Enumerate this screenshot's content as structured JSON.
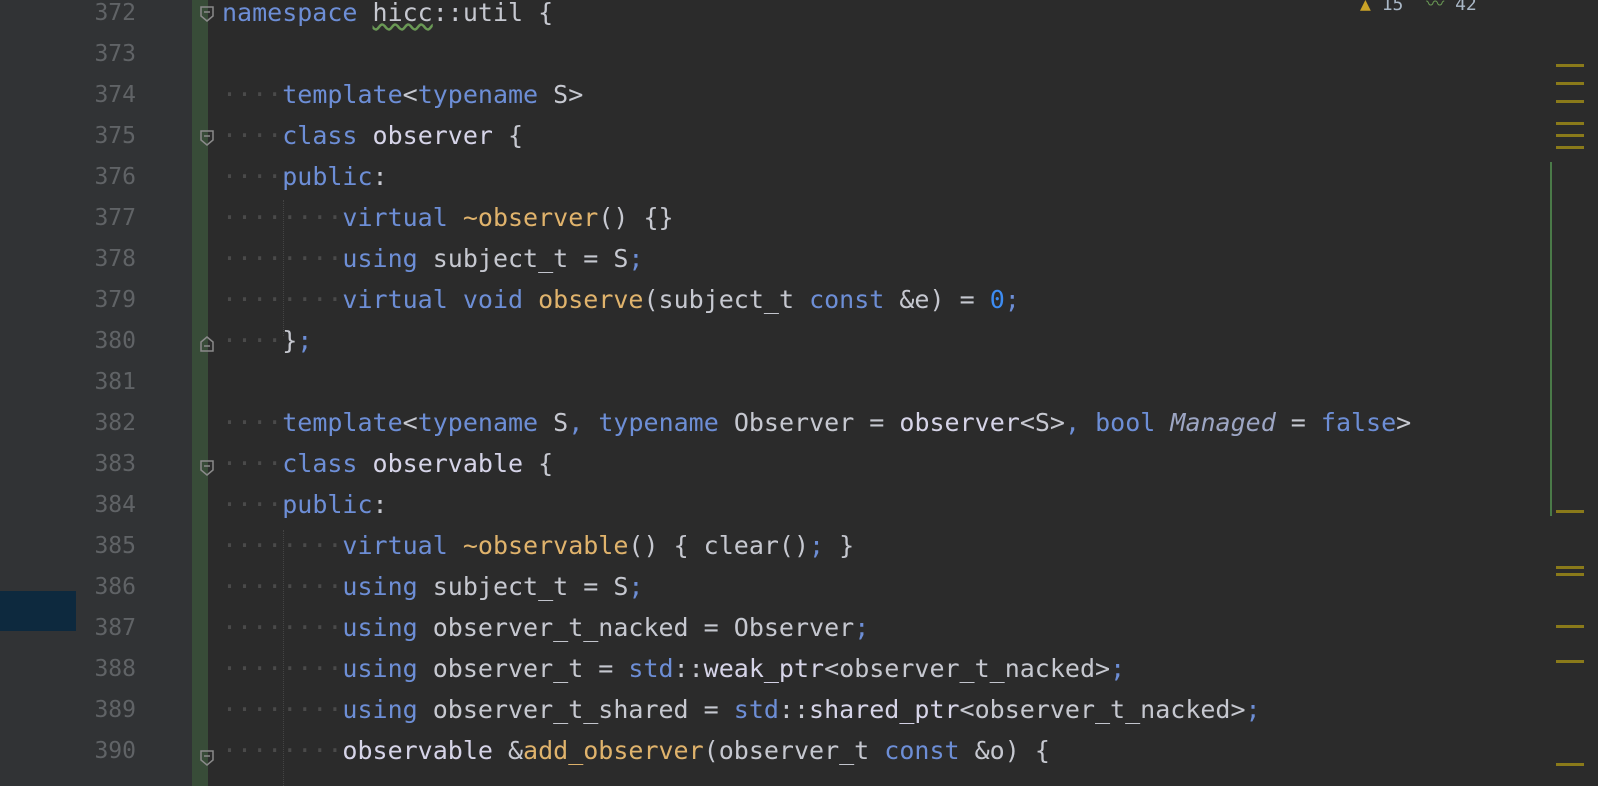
{
  "gutter": {
    "line_numbers": [
      "372",
      "373",
      "374",
      "375",
      "376",
      "377",
      "378",
      "379",
      "380",
      "381",
      "382",
      "383",
      "384",
      "385",
      "386",
      "387",
      "388",
      "389",
      "390"
    ]
  },
  "status": {
    "warnings": "15",
    "weak_warnings": "42"
  },
  "code_lines": {
    "l372": {
      "t1": "namespace",
      "t2": " ",
      "t3": "hicc",
      "t4": "::",
      "t5": "util",
      "t6": " {"
    },
    "l374": {
      "t1": "template",
      "t2": "<",
      "t3": "typename",
      "t4": " S>"
    },
    "l375": {
      "t1": "class",
      "t2": " ",
      "t3": "observer",
      "t4": " {"
    },
    "l376": {
      "t1": "public",
      "t2": ":"
    },
    "l377": {
      "t1": "virtual",
      "t2": " ",
      "t3": "~observer",
      "t4": "() {}"
    },
    "l378": {
      "t1": "using",
      "t2": " subject_t = S",
      "t3": ";"
    },
    "l379": {
      "t1": "virtual",
      "t2": " ",
      "t3": "void",
      "t4": " ",
      "t5": "observe",
      "t6": "(subject_t ",
      "t7": "const",
      "t8": " &e) = ",
      "t9": "0",
      "t10": ";"
    },
    "l380": {
      "t1": "}",
      "t2": ";"
    },
    "l382": {
      "t1": "template",
      "t2": "<",
      "t3": "typename",
      "t4": " S",
      "t5": ",",
      "t6": " ",
      "t7": "typename",
      "t8": " Observer = ",
      "t9": "observer",
      "t10": "<S>",
      "t11": ",",
      "t12": " ",
      "t13": "bool",
      "t14": " ",
      "t15": "Managed",
      "t16": " = ",
      "t17": "false",
      "t18": ">"
    },
    "l383": {
      "t1": "class",
      "t2": " ",
      "t3": "observable",
      "t4": " {"
    },
    "l384": {
      "t1": "public",
      "t2": ":"
    },
    "l385": {
      "t1": "virtual",
      "t2": " ",
      "t3": "~observable",
      "t4": "() { clear()",
      "t5": ";",
      "t6": " }"
    },
    "l386": {
      "t1": "using",
      "t2": " subject_t = S",
      "t3": ";"
    },
    "l387": {
      "t1": "using",
      "t2": " observer_t_nacked = Observer",
      "t3": ";"
    },
    "l388": {
      "t1": "using",
      "t2": " observer_t = ",
      "t3": "std",
      "t4": "::",
      "t5": "weak_ptr",
      "t6": "<observer_t_nacked>",
      "t7": ";"
    },
    "l389": {
      "t1": "using",
      "t2": " observer_t_shared = ",
      "t3": "std",
      "t4": "::",
      "t5": "shared_ptr",
      "t6": "<observer_t_nacked>",
      "t7": ";"
    },
    "l390": {
      "t1": "observable",
      "t2": " &",
      "t3": "add_observer",
      "t4": "(observer_t ",
      "t5": "const",
      "t6": " &o) {"
    }
  },
  "colors": {
    "keyword": "#6d8ed6",
    "function": "#e0b36c",
    "number": "#3d8cf2",
    "background": "#2b2b2b"
  }
}
